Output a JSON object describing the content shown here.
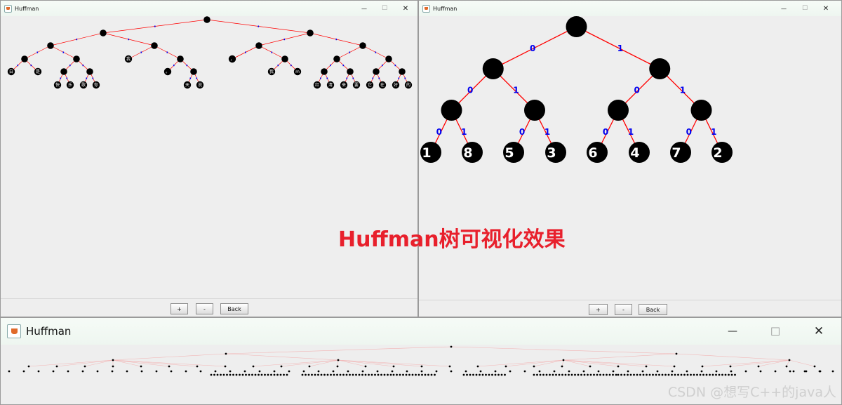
{
  "windows": {
    "left": {
      "title": "Huffman",
      "buttons": {
        "zoom_in": "+",
        "zoom_out": "-",
        "back": "Back"
      }
    },
    "right": {
      "title": "Huffman",
      "buttons": {
        "zoom_in": "+",
        "zoom_out": "-",
        "back": "Back"
      }
    },
    "bottom": {
      "title": "Huffman"
    }
  },
  "window_controls": {
    "minimize": "—",
    "maximize": "☐",
    "close": "✕"
  },
  "caption": "Huffman树可视化效果",
  "watermark": "CSDN @想写C++的java人",
  "colors": {
    "edge": "#ff0000",
    "edge_label": "#0000ee",
    "node": "#000000",
    "node_text": "#ffffff",
    "caption": "#e8202c"
  },
  "trees": {
    "right_tree": {
      "edge_labels": {
        "left": "0",
        "right": "1"
      },
      "leaves": [
        "1",
        "8",
        "5",
        "3",
        "6",
        "4",
        "7",
        "2"
      ]
    },
    "left_tree": {
      "leaves": [
        "白",
        "是",
        "快",
        "乐",
        "我",
        "歌",
        "你",
        "雪",
        "。",
        "天",
        "说",
        "，",
        "我",
        "m",
        "红",
        "清",
        "来",
        "要",
        "它",
        "在",
        "好",
        "的"
      ]
    }
  }
}
